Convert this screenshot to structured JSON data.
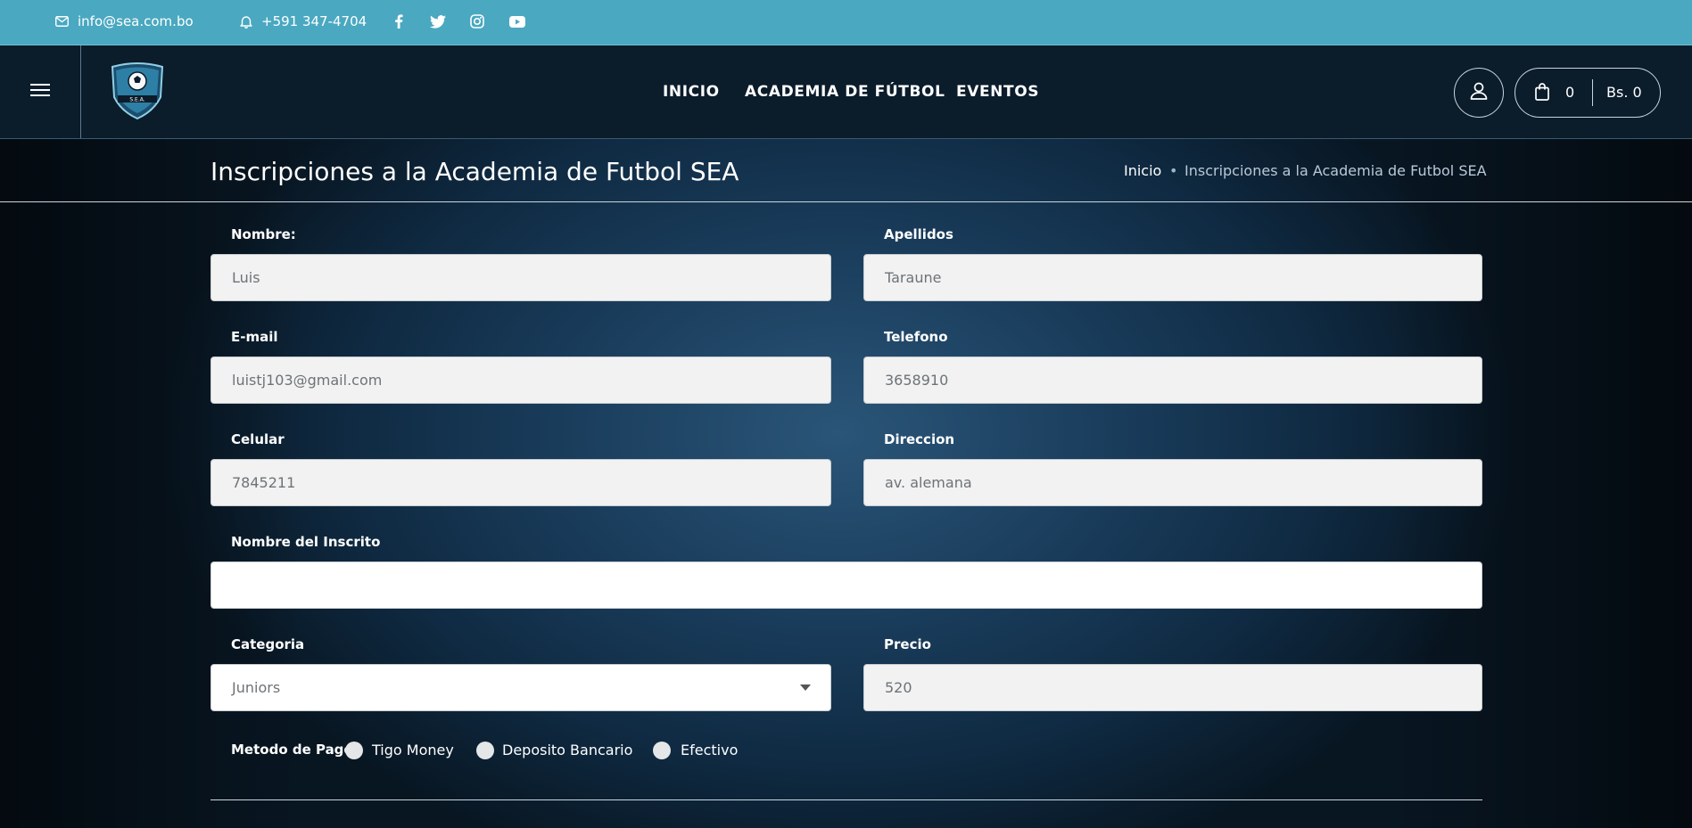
{
  "topbar": {
    "email": "info@sea.com.bo",
    "phone": "+591 347-4704",
    "social_icons": [
      "facebook-icon",
      "twitter-icon",
      "instagram-icon",
      "youtube-icon"
    ]
  },
  "header": {
    "nav": [
      "INICIO",
      "ACADEMIA DE FÚTBOL",
      "EVENTOS"
    ],
    "cart": {
      "count": "0",
      "total": "Bs. 0"
    }
  },
  "page": {
    "title": "Inscripciones a la Academia de Futbol SEA",
    "breadcrumb": {
      "home": "Inicio",
      "separator": "•",
      "current": "Inscripciones a la Academia de Futbol SEA"
    }
  },
  "form": {
    "nombre": {
      "label": "Nombre:",
      "value": "Luis"
    },
    "apellidos": {
      "label": "Apellidos",
      "value": "Taraune"
    },
    "email": {
      "label": "E-mail",
      "value": "luistj103@gmail.com"
    },
    "telefono": {
      "label": "Telefono",
      "value": "3658910"
    },
    "celular": {
      "label": "Celular",
      "value": "7845211"
    },
    "direccion": {
      "label": "Direccion",
      "value": "av. alemana"
    },
    "nombre_inscrito": {
      "label": "Nombre del Inscrito",
      "value": ""
    },
    "categoria": {
      "label": "Categoria",
      "value": "Juniors"
    },
    "precio": {
      "label": "Precio",
      "value": "520"
    },
    "metodo_pago": {
      "label": "Metodo de Pago",
      "options": [
        "Tigo Money",
        "Deposito Bancario",
        "Efectivo"
      ]
    }
  },
  "colors": {
    "topbar": "#4aa8c1",
    "header": "#0b1c2b",
    "field_bg": "#f2f2f2"
  }
}
